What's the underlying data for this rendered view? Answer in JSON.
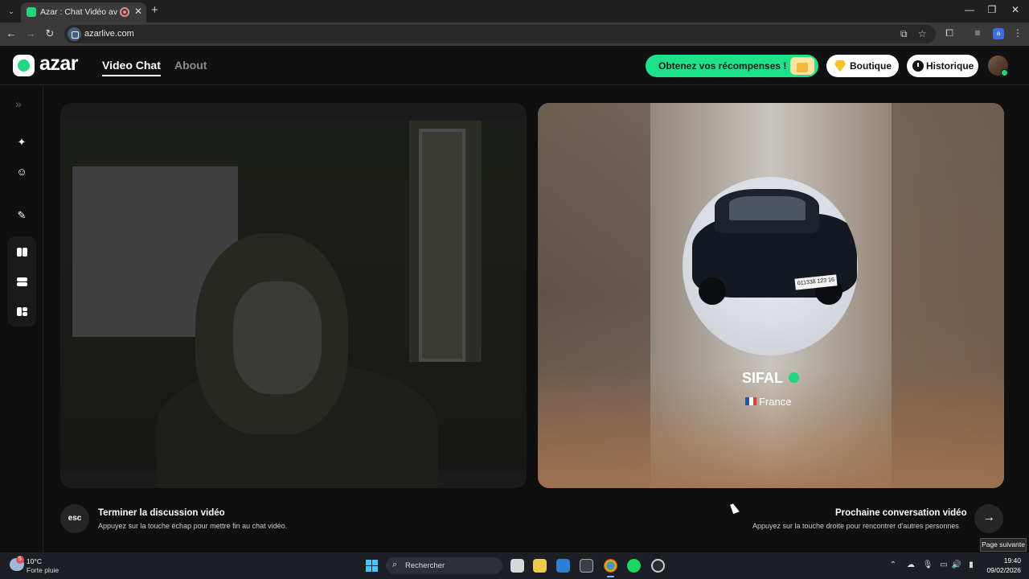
{
  "browser": {
    "tab_title": "Azar : Chat Vidéo avec de n",
    "url": "azarlive.com",
    "new_tab_symbol": "+",
    "close_symbol": "✕"
  },
  "header": {
    "logo_text": "azar",
    "nav": {
      "video_chat": "Video Chat",
      "about": "About"
    },
    "rewards_label": "Obtenez vos récompenses !",
    "shop_label": "Boutique",
    "history_label": "Historique"
  },
  "peer": {
    "name": "SIFAL",
    "country": "France",
    "plate_text": "011338 123 16"
  },
  "hints": {
    "end_key": "esc",
    "end_title": "Terminer la discussion vidéo",
    "end_sub": "Appuyez sur la touche échap pour mettre fin au chat vidéo.",
    "next_title": "Prochaine conversation vidéo",
    "next_sub": "Appuyez sur la touche droite pour rencontrer d'autres personnes",
    "next_symbol": "→",
    "tooltip": "Page suivante"
  },
  "taskbar": {
    "weather_badge": "5",
    "temperature": "10°C",
    "weather": "Forte pluie",
    "search_label": "Rechercher",
    "time": "19:40",
    "date": "09/02/2026"
  },
  "colors": {
    "accent": "#1ee28a",
    "brand_green": "#20d584"
  }
}
